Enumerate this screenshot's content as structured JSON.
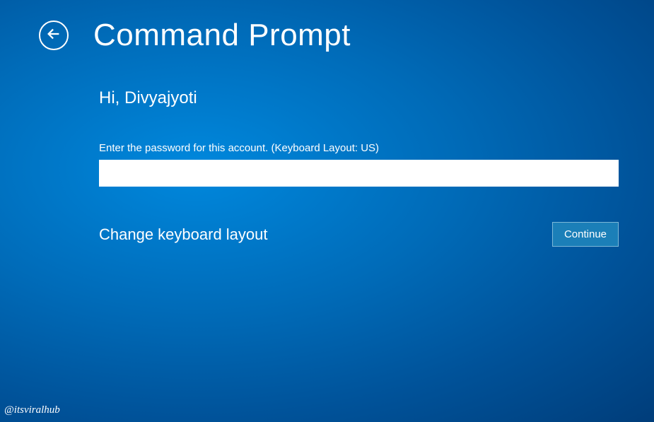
{
  "header": {
    "title": "Command Prompt"
  },
  "content": {
    "greeting": "Hi, Divyajyoti",
    "password_label": "Enter the password for this account. (Keyboard Layout: US)",
    "password_value": "",
    "change_layout_label": "Change keyboard layout",
    "continue_label": "Continue"
  },
  "watermark": "@itsviralhub"
}
